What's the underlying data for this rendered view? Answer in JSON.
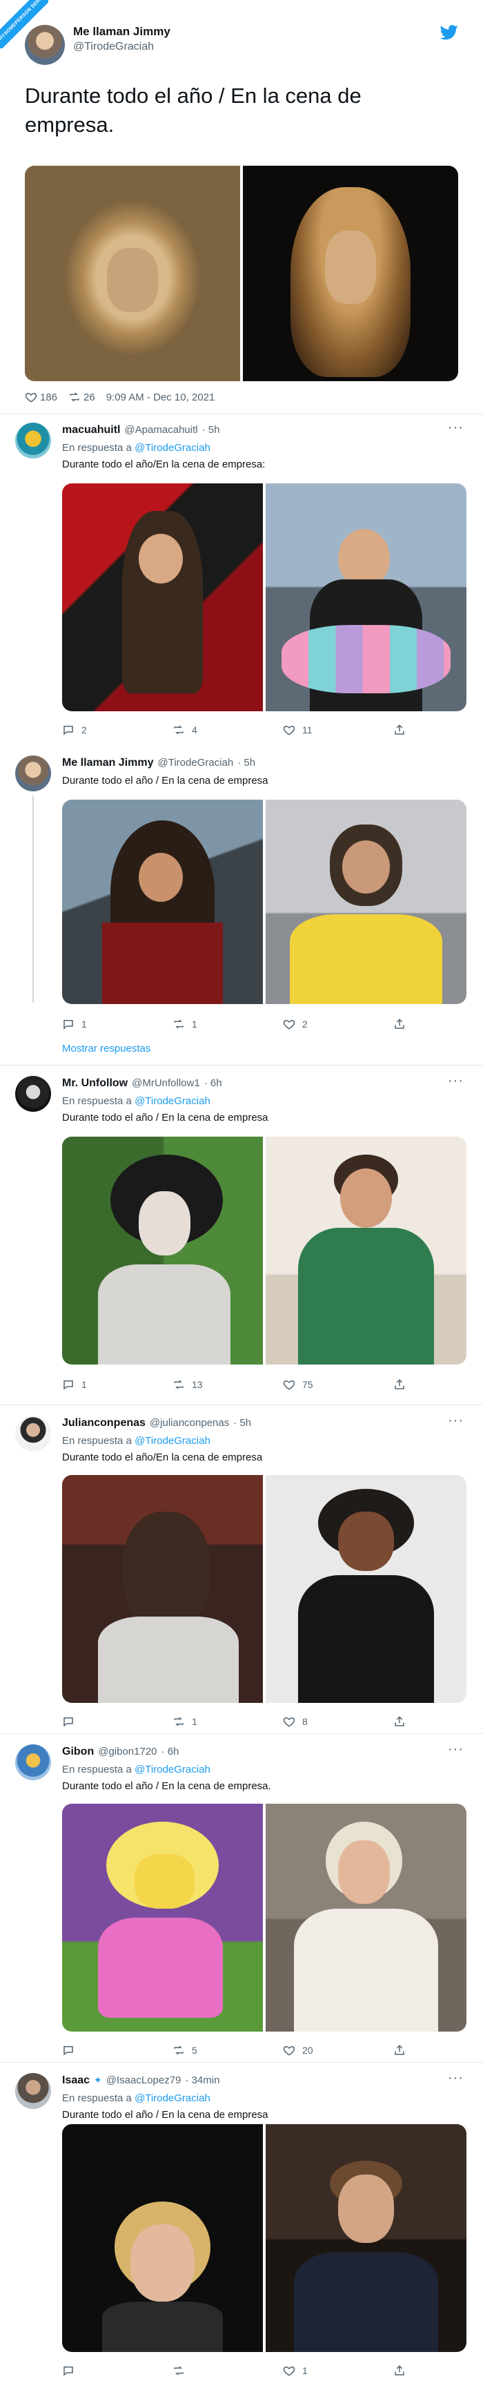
{
  "corner_badge": "WHYSOMEPERSON\nSERIOUS",
  "main": {
    "author_name": "Me llaman Jimmy",
    "author_handle": "@TirodeGraciah",
    "text": "Durante todo el año / En la cena de empresa.",
    "likes": "186",
    "retweets": "26",
    "timestamp": "9:09 AM - Dec 10, 2021",
    "colors": {
      "accent": "#1d9bf0",
      "muted": "#536471"
    }
  },
  "replies": [
    {
      "name": "macuahuitl",
      "handle": "@Apamacahuitl",
      "time": "· 5h",
      "in_reply": "En respuesta a",
      "reply_to": "@TirodeGraciah",
      "text": "Durante todo el año/En la cena de empresa:",
      "replies": "2",
      "retweets": "4",
      "likes": "11"
    },
    {
      "name": "Me llaman Jimmy",
      "handle": "@TirodeGraciah",
      "time": "· 5h",
      "text": "Durante todo el año / En la cena de empresa",
      "replies": "1",
      "retweets": "1",
      "likes": "2",
      "show_replies": "Mostrar respuestas"
    },
    {
      "name": "Mr. Unfollow",
      "handle": "@MrUnfollow1",
      "time": "· 6h",
      "in_reply": "En respuesta a",
      "reply_to": "@TirodeGraciah",
      "text": "Durante todo el año / En la cena de empresa",
      "replies": "1",
      "retweets": "13",
      "likes": "75"
    },
    {
      "name": "Julianconpenas",
      "handle": "@julianconpenas",
      "time": "· 5h",
      "in_reply": "En respuesta a",
      "reply_to": "@TirodeGraciah",
      "text": "Durante todo el año/En la cena de empresa",
      "replies": "",
      "retweets": "1",
      "likes": "8"
    },
    {
      "name": "Gibon",
      "handle": "@gibon1720",
      "time": "· 6h",
      "in_reply": "En respuesta a",
      "reply_to": "@TirodeGraciah",
      "text": "Durante todo el año / En la cena de empresa.",
      "replies": "",
      "retweets": "5",
      "likes": "20"
    },
    {
      "name": "Isaac",
      "handle": "@IsaacLopez79",
      "time": "· 34min",
      "in_reply": "En respuesta a",
      "reply_to": "@TirodeGraciah",
      "text": "Durante todo el año / En la cena de empresa",
      "replies": "",
      "retweets": "",
      "likes": "1"
    }
  ]
}
